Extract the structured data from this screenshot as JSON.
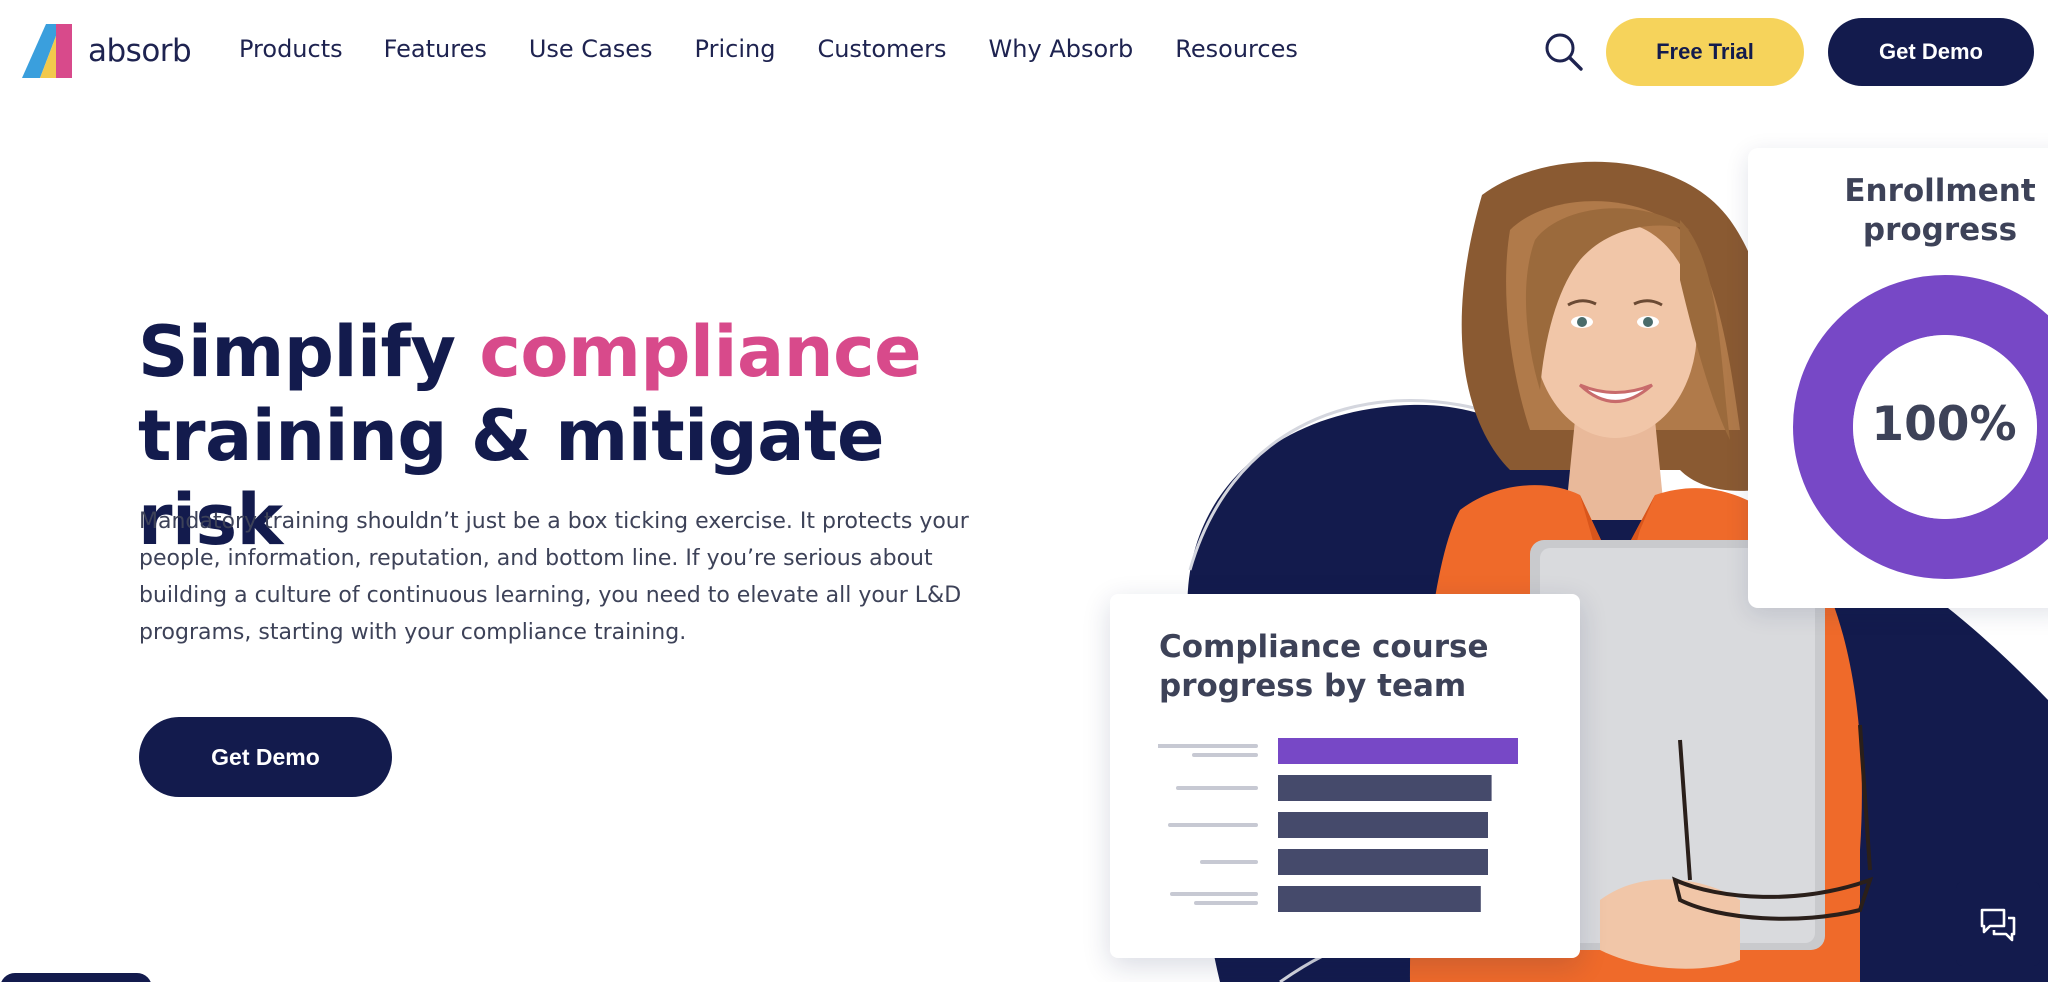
{
  "brand": {
    "name": "absorb",
    "logo_icon": "absorb-logo"
  },
  "nav": {
    "items": [
      {
        "label": "Products"
      },
      {
        "label": "Features"
      },
      {
        "label": "Use Cases"
      },
      {
        "label": "Pricing"
      },
      {
        "label": "Customers"
      },
      {
        "label": "Why Absorb"
      },
      {
        "label": "Resources"
      }
    ],
    "search_icon": "search-icon",
    "free_trial_label": "Free Trial",
    "get_demo_label": "Get Demo"
  },
  "hero": {
    "headline_part1": "Simplify ",
    "headline_accent": "compliance",
    "headline_part2": "training & mitigate risk",
    "body": "Mandatory training shouldn’t just be a box ticking exercise. It protects your people, information, reputation, and bottom line. If you’re serious about building a culture of continuous learning, you need to elevate all your L&D programs, starting with your compliance training.",
    "cta_label": "Get Demo"
  },
  "cards": {
    "enrollment": {
      "title": "Enrollment progress",
      "value": "100%",
      "progress": 1.0
    },
    "course_progress": {
      "title": "Compliance course progress by team",
      "bar_fractions": [
        1.0,
        0.89,
        0.875,
        0.875,
        0.845
      ],
      "highlight_color": "#7748c6",
      "bar_color": "#454a6b"
    }
  },
  "chat": {
    "icon": "chat-bubbles-icon"
  },
  "colors": {
    "navy": "#131b4d",
    "pink_accent": "#d84a8b",
    "yellow": "#f6d35b",
    "purple": "#7748c6",
    "orange_jacket": "#ef6a2a"
  }
}
